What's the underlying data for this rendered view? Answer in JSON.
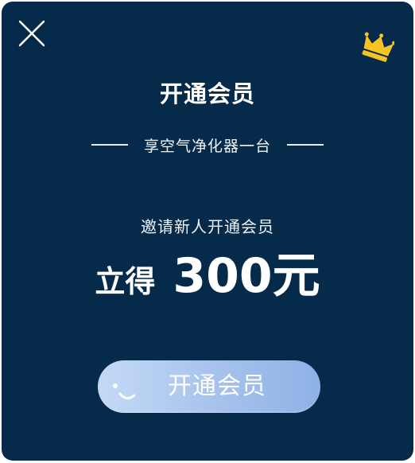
{
  "dialog": {
    "title": "开通会员",
    "subtitle": "享空气净化器一台",
    "invite_text": "邀请新人开通会员",
    "reward_prefix": "立得",
    "reward_amount": "300元",
    "cta_label": "开通会员"
  },
  "icons": {
    "close": "close-icon",
    "crown": "crown-icon",
    "cta_face": "smile-face-icon"
  },
  "colors": {
    "background": "#062b4a",
    "crown": "#f6c325",
    "button_start": "#c4d9f6",
    "button_end": "#8eb1e6",
    "text": "#ffffff"
  }
}
